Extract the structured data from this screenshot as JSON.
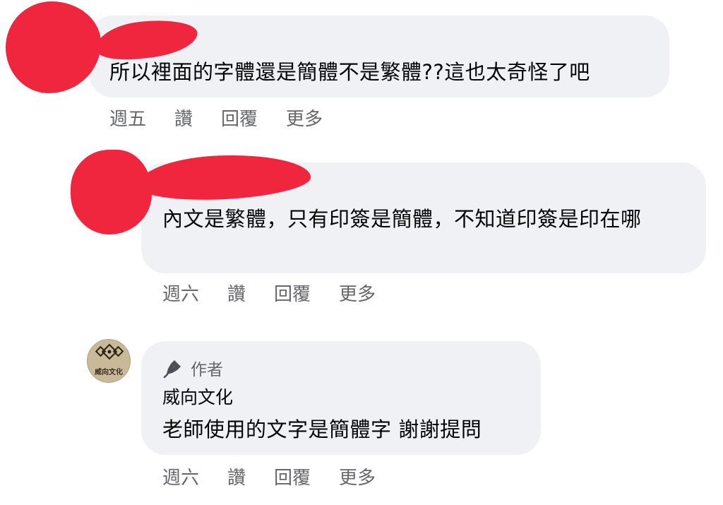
{
  "comments": [
    {
      "text": "所以裡面的字體還是簡體不是繁體??這也太奇怪了吧",
      "actions": {
        "time": "週五",
        "like": "讚",
        "reply": "回覆",
        "more": "更多"
      }
    },
    {
      "text": "內文是繁體，只有印簽是簡體，不知道印簽是印在哪",
      "actions": {
        "time": "週六",
        "like": "讚",
        "reply": "回覆",
        "more": "更多"
      }
    },
    {
      "author_badge": "作者",
      "author_name": "威向文化",
      "avatar_label": "威向文化",
      "text": "老師使用的文字是簡體字 謝謝提問",
      "actions": {
        "time": "週六",
        "like": "讚",
        "reply": "回覆",
        "more": "更多"
      }
    }
  ],
  "colors": {
    "bubble": "#eff1f4",
    "text": "#050505",
    "secondary_text": "#65676b",
    "redaction": "#f0263f",
    "avatar_bg": "#c8b999"
  },
  "icons": {
    "author_badge_icon": "pen-icon"
  }
}
